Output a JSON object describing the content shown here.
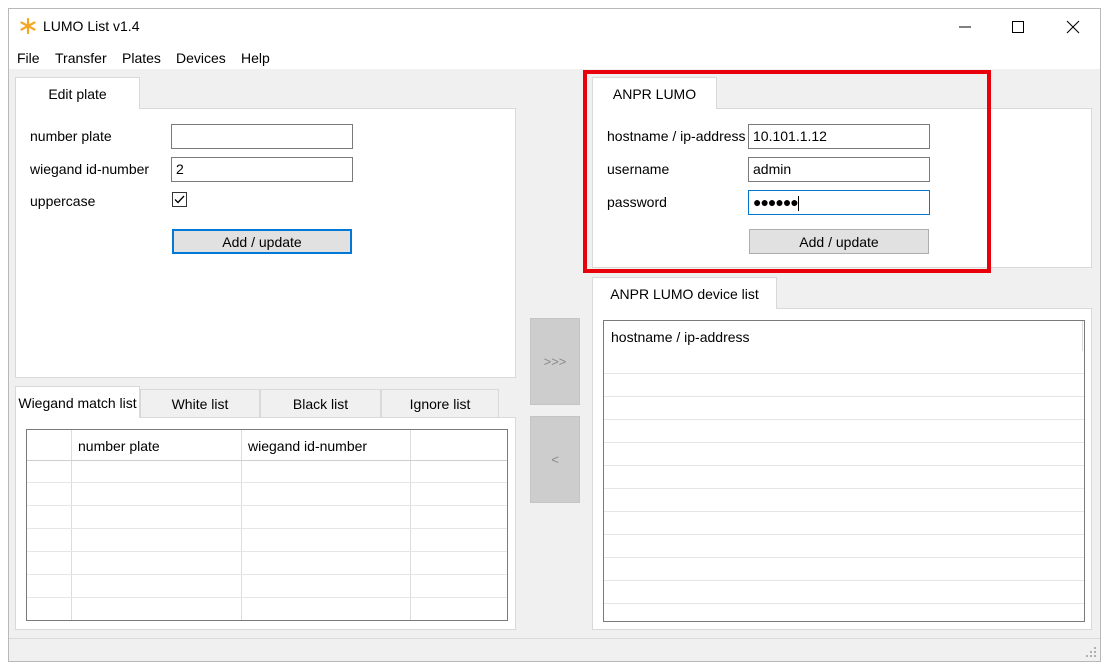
{
  "window": {
    "title": "LUMO List v1.4",
    "minimize_icon": "minimize-icon",
    "maximize_icon": "maximize-icon",
    "close_icon": "close-icon",
    "app_icon": "star-icon",
    "app_icon_color": "#f5a623"
  },
  "menu": [
    "File",
    "Transfer",
    "Plates",
    "Devices",
    "Help"
  ],
  "edit_plate": {
    "tab_label": "Edit plate",
    "number_plate_label": "number plate",
    "number_plate_value": "",
    "wiegand_label": "wiegand id-number",
    "wiegand_value": "2",
    "uppercase_label": "uppercase",
    "uppercase_checked": true,
    "add_update_label": "Add / update"
  },
  "lists": {
    "tabs": [
      "Wiegand match list",
      "White list",
      "Black list",
      "Ignore list"
    ],
    "active_tab": "Wiegand match list",
    "columns": [
      "number plate",
      "wiegand id-number"
    ]
  },
  "transfer": {
    "right_label": ">>>",
    "left_label": "<"
  },
  "anpr": {
    "tab_label": "ANPR LUMO",
    "hostname_label": "hostname / ip-address",
    "hostname_value": "10.101.1.12",
    "username_label": "username",
    "username_value": "admin",
    "password_label": "password",
    "password_value": "●●●●●●",
    "add_update_label": "Add / update",
    "highlight_color": "#e8000b"
  },
  "device_list": {
    "tab_label": "ANPR LUMO device list",
    "column": "hostname / ip-address"
  }
}
